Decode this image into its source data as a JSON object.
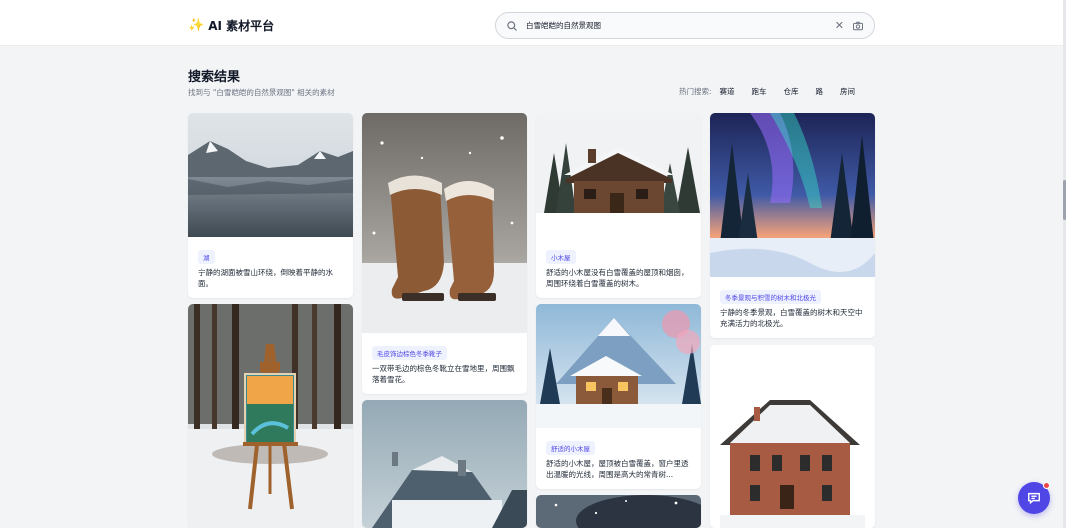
{
  "header": {
    "logo_icon": "sparkles-icon",
    "logo_text": "AI 素材平台",
    "search_value": "白雪皑皑的自然景观图",
    "search_icon": "search-icon",
    "clear_icon": "close-icon",
    "camera_icon": "camera-icon"
  },
  "results": {
    "title": "搜索结果",
    "subtitle": "找到与 \"白雪皑皑的自然景观图\" 相关的素材",
    "hot_label": "热门搜索:",
    "hot_tags": [
      "赛道",
      "跑车",
      "仓库",
      "路",
      "房间"
    ]
  },
  "cards": [
    {
      "tag": "湖",
      "desc": "宁静的湖面被雪山环绕，倒映着平静的水面。"
    },
    {
      "tag": "毛皮饰边棕色冬季靴子",
      "desc": "一双带毛边的棕色冬靴立在雪地里，周围飘落着雪花。"
    },
    {
      "tag": "小木屋",
      "desc": "舒适的小木屋没有白雪覆盖的屋顶和烟囱，周围环绕着白雪覆盖的树木。"
    },
    {
      "tag": "冬季景观与积雪的树木和北极光",
      "desc": "宁静的冬季景观，白雪覆盖的树木和天空中充满活力的北极光。"
    },
    {
      "tag": "舒适的小木屋",
      "desc": "舒适的小木屋，屋顶被白雪覆盖，窗户里透出温暖的光线，周围是高大的常青树..."
    }
  ],
  "colors": {
    "accent": "#4f46e5",
    "badge_bg": "#eef2ff",
    "page_bg": "#f3f4f6",
    "notification": "#ef4444"
  },
  "chat": {
    "icon": "chat-icon"
  }
}
